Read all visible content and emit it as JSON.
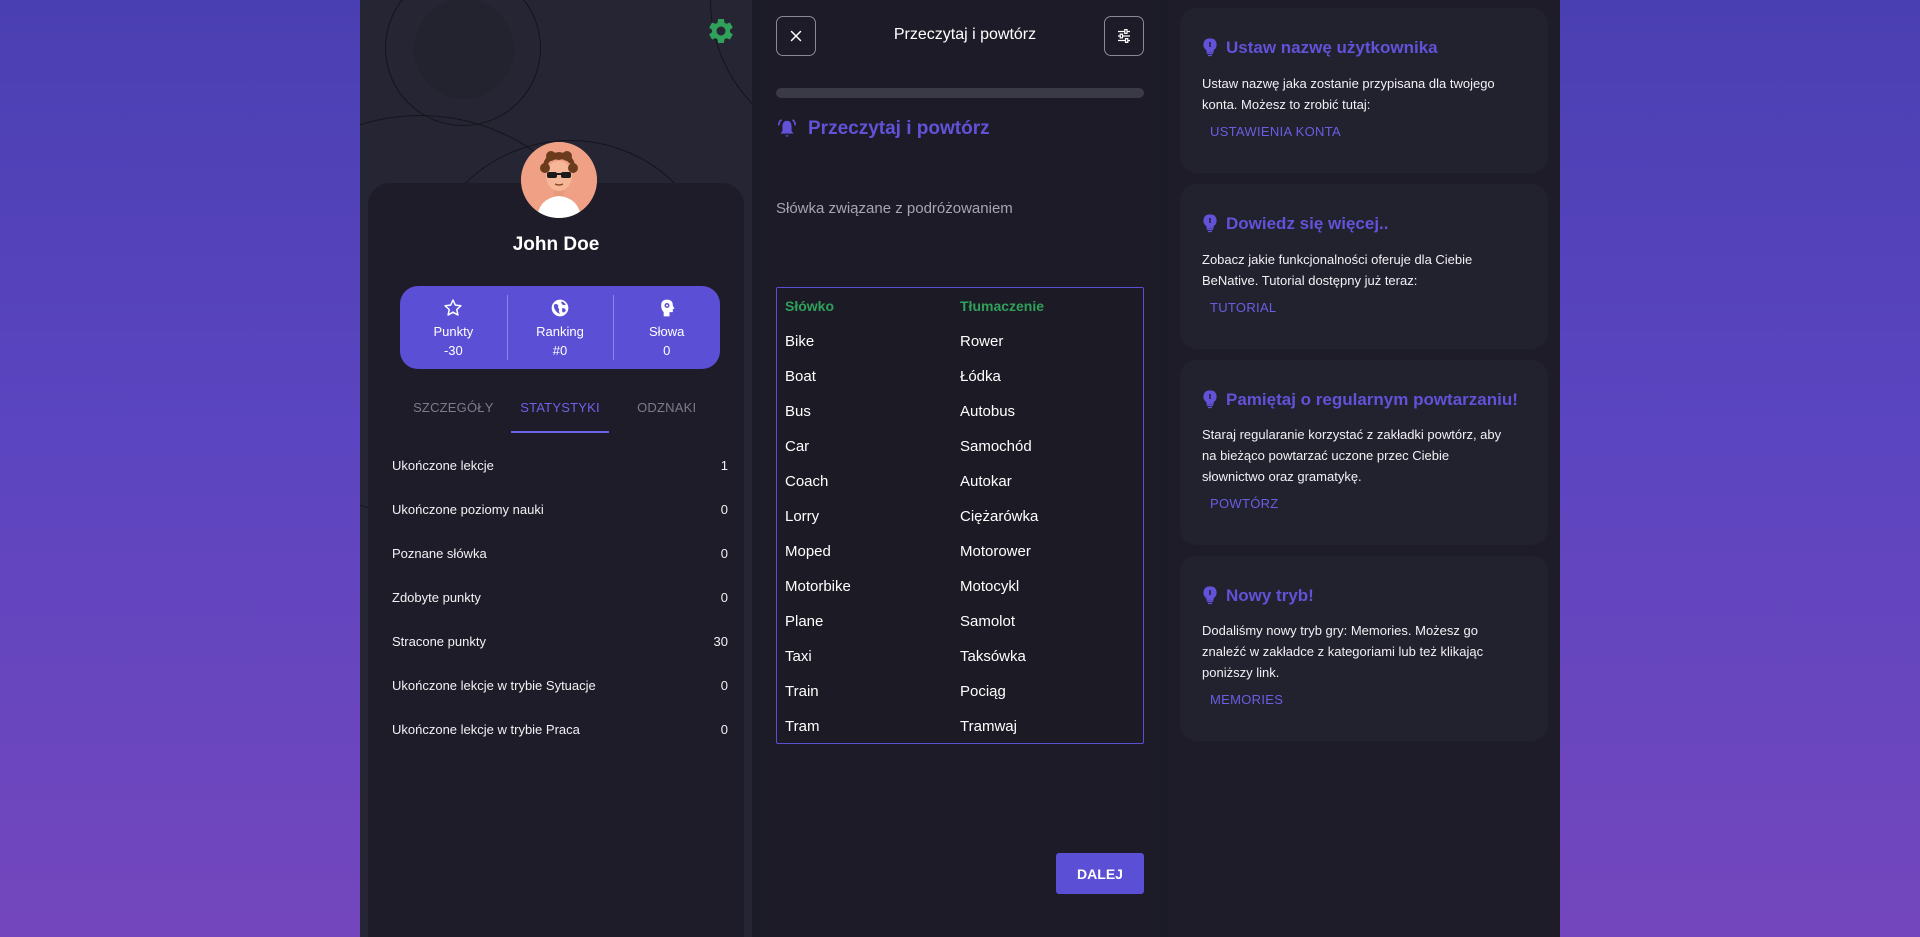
{
  "profile": {
    "name": "John Doe",
    "stats": [
      {
        "label": "Punkty",
        "value": "-30",
        "icon": "star-icon"
      },
      {
        "label": "Ranking",
        "value": "#0",
        "icon": "globe-icon"
      },
      {
        "label": "Słowa",
        "value": "0",
        "icon": "brain-icon"
      }
    ],
    "tabs": [
      "SZCZEGÓŁY",
      "STATYSTYKI",
      "ODZNAKI"
    ],
    "active_tab": "STATYSTYKI",
    "statistics": [
      {
        "label": "Ukończone lekcje",
        "value": "1"
      },
      {
        "label": "Ukończone poziomy nauki",
        "value": "0"
      },
      {
        "label": "Poznane słówka",
        "value": "0"
      },
      {
        "label": "Zdobyte punkty",
        "value": "0"
      },
      {
        "label": "Stracone punkty",
        "value": "30"
      },
      {
        "label": "Ukończone lekcje w trybie Sytuacje",
        "value": "0"
      },
      {
        "label": "Ukończone lekcje w trybie Praca",
        "value": "0"
      }
    ]
  },
  "lesson": {
    "header_title": "Przeczytaj i powtórz",
    "section_title": "Przeczytaj i powtórz",
    "subtitle": "Słówka związane z podróżowaniem",
    "progress": 0,
    "table_headers": [
      "Słówko",
      "Tłumaczenie"
    ],
    "words": [
      [
        "Bike",
        "Rower"
      ],
      [
        "Boat",
        "Łódka"
      ],
      [
        "Bus",
        "Autobus"
      ],
      [
        "Car",
        "Samochód"
      ],
      [
        "Coach",
        "Autokar"
      ],
      [
        "Lorry",
        "Ciężarówka"
      ],
      [
        "Moped",
        "Motorower"
      ],
      [
        "Motorbike",
        "Motocykl"
      ],
      [
        "Plane",
        "Samolot"
      ],
      [
        "Taxi",
        "Taksówka"
      ],
      [
        "Train",
        "Pociąg"
      ],
      [
        "Tram",
        "Tramwaj"
      ]
    ],
    "next_label": "DALEJ"
  },
  "tips": [
    {
      "title": "Ustaw nazwę użytkownika",
      "lines": [
        "Ustaw nazwę jaka zostanie przypisana dla twojego",
        "konta. Możesz to zrobić tutaj:"
      ],
      "link": "USTAWIENIA KONTA"
    },
    {
      "title": "Dowiedz się więcej..",
      "lines": [
        "Zobacz jakie funkcjonalności oferuje dla Ciebie",
        "BeNative. Tutorial dostępny już teraz:"
      ],
      "link": "TUTORIAL"
    },
    {
      "title": "Pamiętaj o regularnym powtarzaniu!",
      "lines": [
        "Staraj regularanie korzystać z zakładki powtórz, aby",
        "na bieżąco powtarzać uczone przec Ciebie",
        "słownictwo oraz gramatykę."
      ],
      "link": "POWTÓRZ"
    },
    {
      "title": "Nowy tryb!",
      "lines": [
        "Dodaliśmy nowy tryb gry: Memories. Możesz go",
        "znaleźć w zakładce z kategoriami lub też klikając",
        "poniższy link."
      ],
      "link": "MEMORIES"
    }
  ],
  "colors": {
    "accent": "#5b4fd6",
    "accent_text": "#6152d8",
    "green": "#2fa15a",
    "panel": "#1d1c28"
  }
}
